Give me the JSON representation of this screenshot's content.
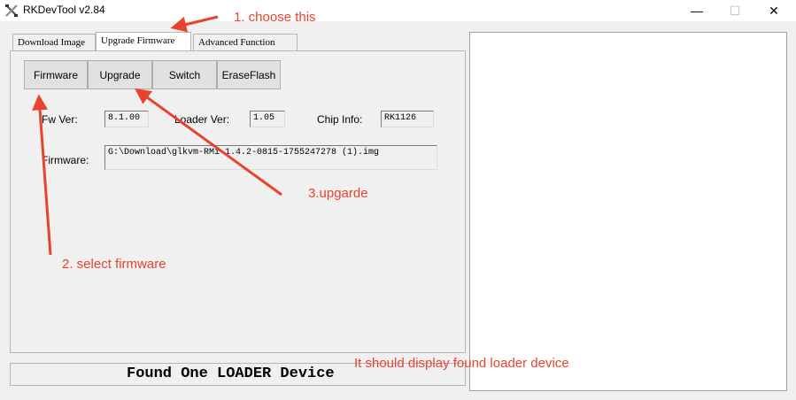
{
  "window": {
    "title": "RKDevTool v2.84",
    "minimize": "—",
    "maximize": "☐",
    "close": "✕"
  },
  "tabs": [
    {
      "label": "Download Image",
      "active": false
    },
    {
      "label": "Upgrade Firmware",
      "active": true
    },
    {
      "label": "Advanced Function",
      "active": false
    }
  ],
  "toolbar": {
    "firmware_label": "Firmware",
    "upgrade_label": "Upgrade",
    "switch_label": "Switch",
    "erase_label": "EraseFlash"
  },
  "info": {
    "fw_ver_label": "Fw Ver:",
    "fw_ver_value": "8.1.00",
    "loader_ver_label": "Loader Ver:",
    "loader_ver_value": "1.05",
    "chip_info_label": "Chip Info:",
    "chip_info_value": "RK1126",
    "firmware_label": "Firmware:",
    "firmware_path": "G:\\Download\\glkvm-RMi-1.4.2-0815-1755247278 (1).img"
  },
  "status": {
    "text": "Found One LOADER Device"
  },
  "annotations": {
    "step1": "1. choose this",
    "step2": "2. select firmware",
    "step3": "3.upgarde",
    "note": "It should display found loader device"
  },
  "colors": {
    "annotation": "#e8432d",
    "panel_bg": "#f0f0f0",
    "button_bg": "#e1e1e1"
  }
}
